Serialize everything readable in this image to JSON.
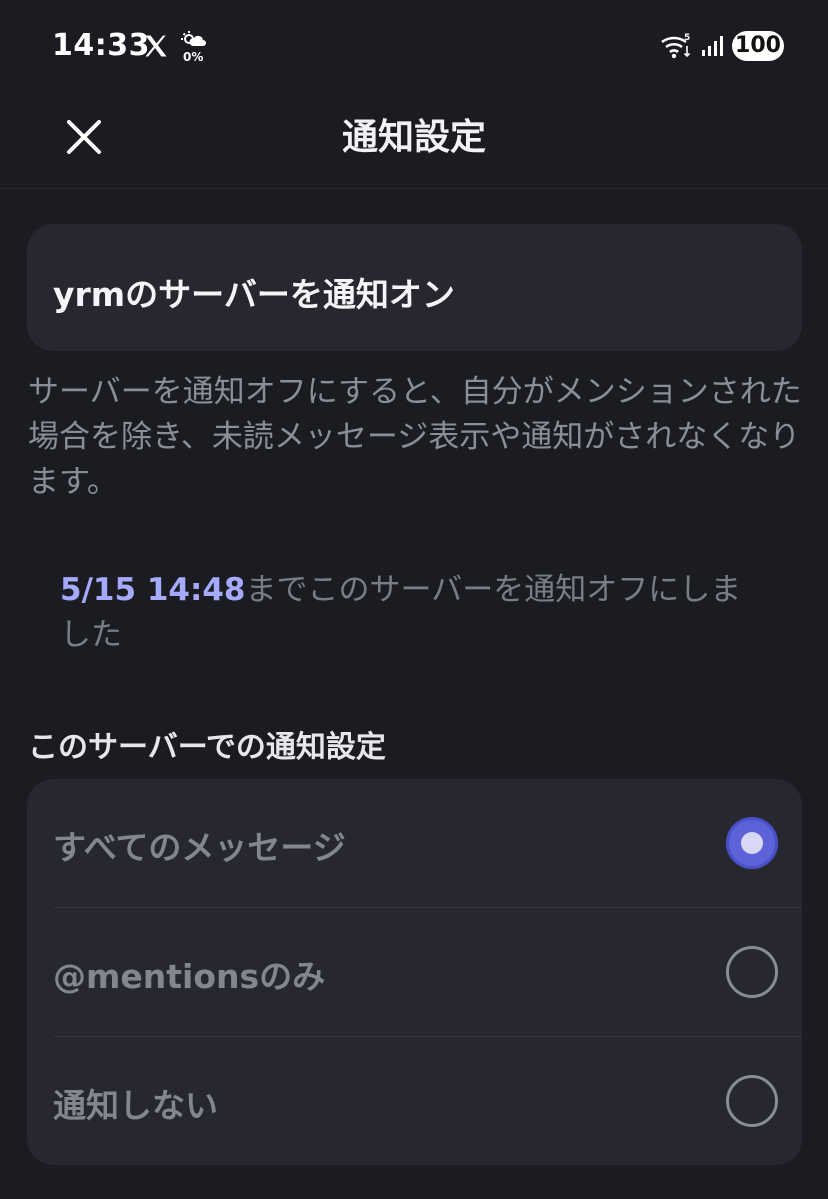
{
  "status_bar": {
    "time": "14:33",
    "weather_percent": "0%",
    "wifi_badge": "5",
    "battery": "100",
    "icons": [
      "x-logo-icon",
      "weather-icon",
      "wifi-icon",
      "signal-icon"
    ]
  },
  "header": {
    "title": "通知設定",
    "close_icon": "close-icon"
  },
  "server_mute": {
    "label": "yrmのサーバーを通知オン"
  },
  "description": "サーバーを通知オフにすると、自分がメンションされた場合を除き、未読メッセージ表示や通知がされなくなります。",
  "muted_info": {
    "date": "5/15 14:48",
    "text": "までこのサーバーを通知オフにしました"
  },
  "section": {
    "title": "このサーバーでの通知設定"
  },
  "options": [
    {
      "label": "すべてのメッセージ",
      "selected": true
    },
    {
      "label": "@mentionsのみ",
      "selected": false
    },
    {
      "label": "通知しない",
      "selected": false
    }
  ],
  "colors": {
    "background": "#1b1c21",
    "card": "#26272f",
    "accent": "#5d62d8",
    "date_text": "#a6aaff"
  }
}
